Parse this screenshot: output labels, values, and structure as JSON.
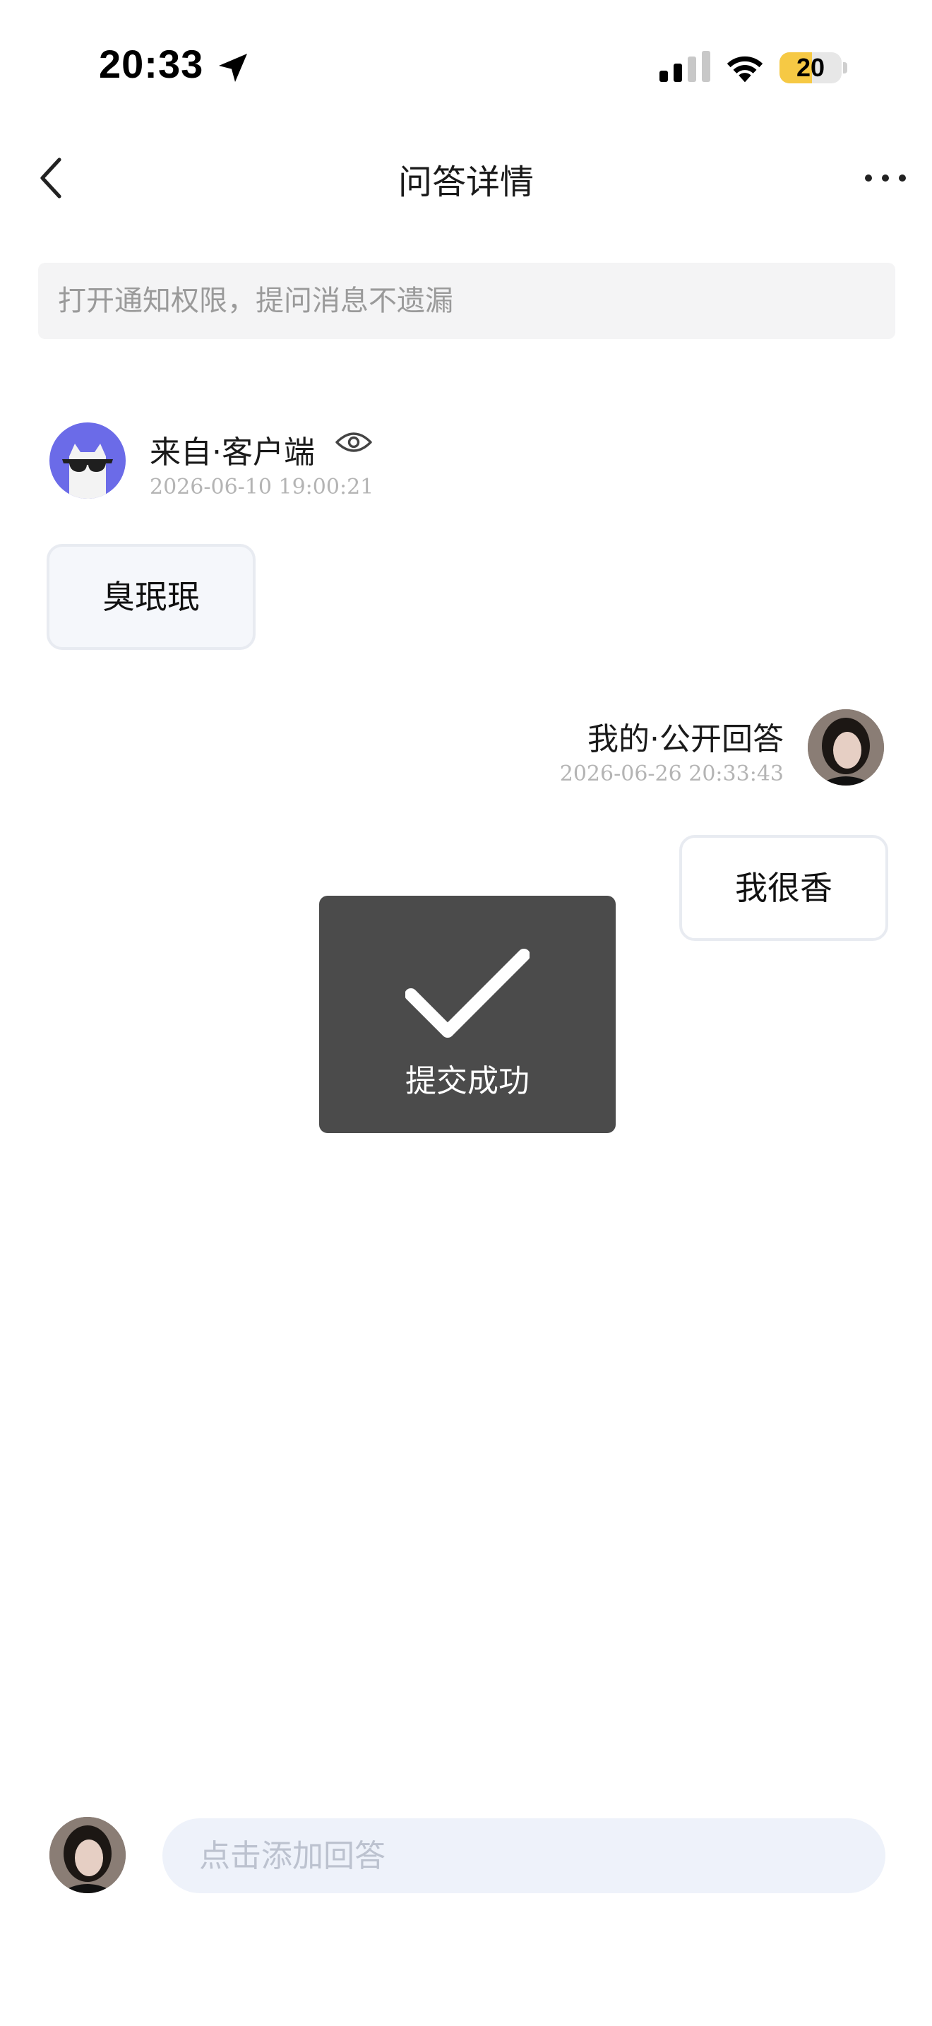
{
  "status_bar": {
    "time": "20:33",
    "battery_level": "20",
    "battery_fraction": 0.2
  },
  "nav": {
    "title": "问答详情"
  },
  "notice": {
    "text": "打开通知权限，提问消息不遗漏"
  },
  "question": {
    "author": "来自·客户端",
    "timestamp": "2026-06-10 19:00:21",
    "content": "臭珉珉"
  },
  "answer": {
    "author": "我的·公开回答",
    "timestamp": "2026-06-26 20:33:43",
    "content": "我很香"
  },
  "toast": {
    "text": "提交成功"
  },
  "composer": {
    "placeholder": "点击添加回答"
  },
  "colors": {
    "avatar_bg_question": "#6b6be8",
    "battery_fill": "#f6c944",
    "toast_bg": "#4b4b4b",
    "input_bg": "#eef2fa"
  },
  "icons": {
    "location": "location-arrow-icon",
    "signal": "cellular-signal-icon",
    "wifi": "wifi-icon",
    "back": "chevron-left-icon",
    "more": "more-dots-icon",
    "eye": "eye-icon",
    "check": "checkmark-icon"
  }
}
